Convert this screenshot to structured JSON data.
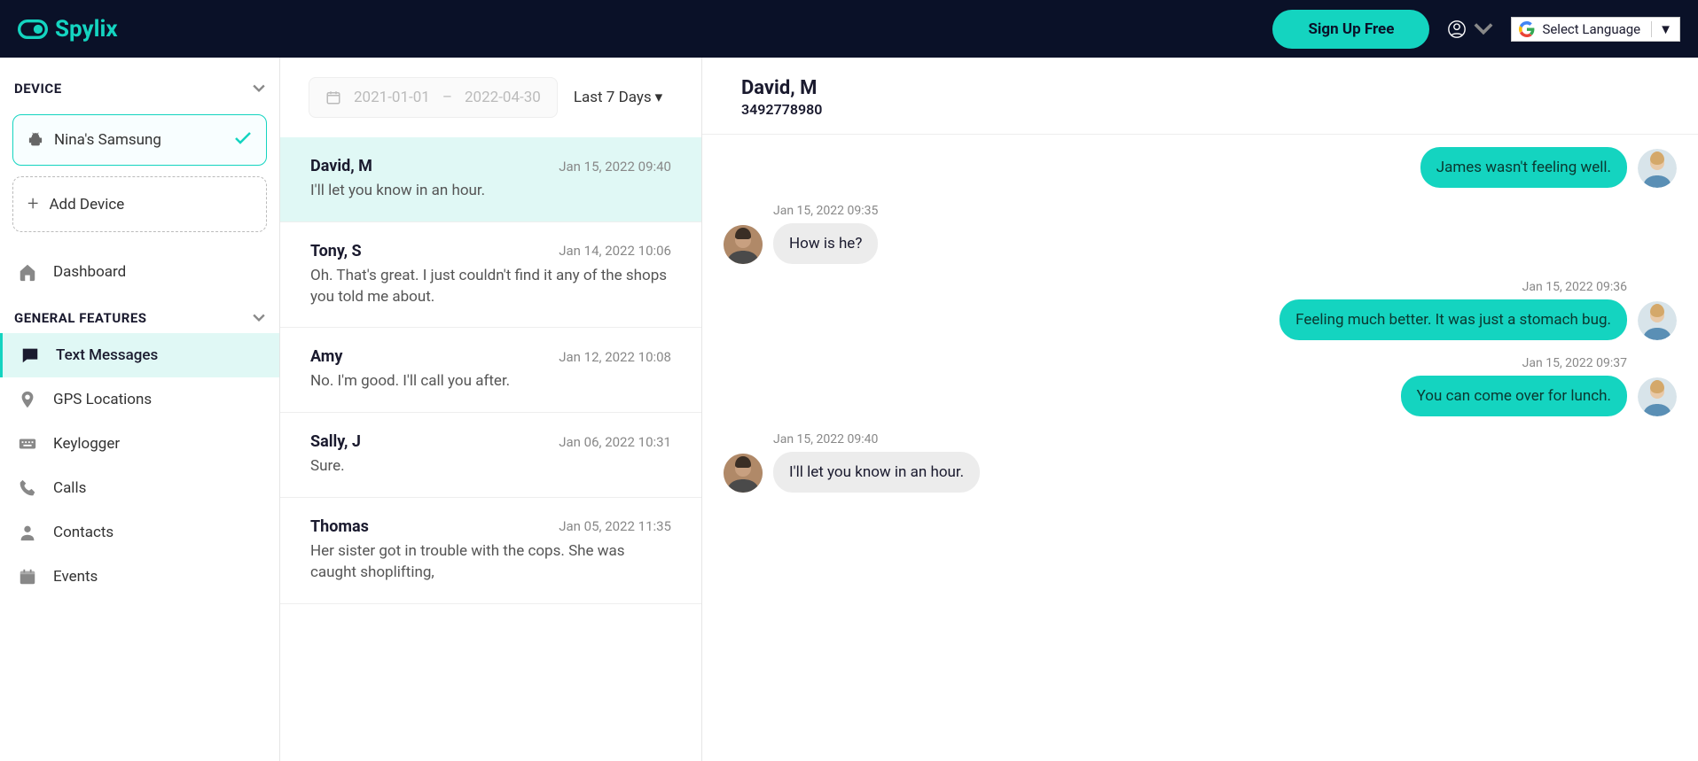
{
  "header": {
    "brand": "Spylix",
    "signup_label": "Sign Up Free",
    "lang_label": "Select Language"
  },
  "sidebar": {
    "device_section": "DEVICE",
    "device_name": "Nina's Samsung",
    "add_device": "Add Device",
    "dashboard": "Dashboard",
    "features_section": "GENERAL FEATURES",
    "items": [
      {
        "label": "Text Messages",
        "icon": "message-icon",
        "active": true
      },
      {
        "label": "GPS Locations",
        "icon": "location-icon",
        "active": false
      },
      {
        "label": "Keylogger",
        "icon": "keyboard-icon",
        "active": false
      },
      {
        "label": "Calls",
        "icon": "phone-icon",
        "active": false
      },
      {
        "label": "Contacts",
        "icon": "person-icon",
        "active": false
      },
      {
        "label": "Events",
        "icon": "calendar-icon",
        "active": false
      }
    ]
  },
  "toolbar": {
    "date_from": "2021-01-01",
    "date_to": "2022-04-30",
    "dash": "–",
    "time_filter": "Last 7 Days"
  },
  "conversations": [
    {
      "name": "David, M",
      "time": "Jan 15, 2022 09:40",
      "preview": "I'll let you know in an hour.",
      "selected": true
    },
    {
      "name": "Tony, S",
      "time": "Jan 14, 2022 10:06",
      "preview": "Oh. That's great. I just couldn't find it any of the shops you told me about.",
      "selected": false
    },
    {
      "name": "Amy",
      "time": "Jan 12, 2022 10:08",
      "preview": "No. I'm good. I'll call you after.",
      "selected": false
    },
    {
      "name": "Sally, J",
      "time": "Jan 06, 2022 10:31",
      "preview": "Sure.",
      "selected": false
    },
    {
      "name": "Thomas",
      "time": "Jan 05, 2022 11:35",
      "preview": "Her sister got in trouble with the cops. She was caught shoplifting,",
      "selected": false
    }
  ],
  "chat": {
    "name": "David, M",
    "phone": "3492778980",
    "messages": [
      {
        "dir": "out",
        "time": "",
        "text": "James wasn't feeling well."
      },
      {
        "dir": "in",
        "time": "Jan 15, 2022 09:35",
        "text": "How is he?"
      },
      {
        "dir": "out",
        "time": "Jan 15, 2022 09:36",
        "text": "Feeling much better. It was just a stomach bug."
      },
      {
        "dir": "out",
        "time": "Jan 15, 2022 09:37",
        "text": "You can come over for lunch."
      },
      {
        "dir": "in",
        "time": "Jan 15, 2022 09:40",
        "text": "I'll let you know in an hour."
      }
    ]
  }
}
